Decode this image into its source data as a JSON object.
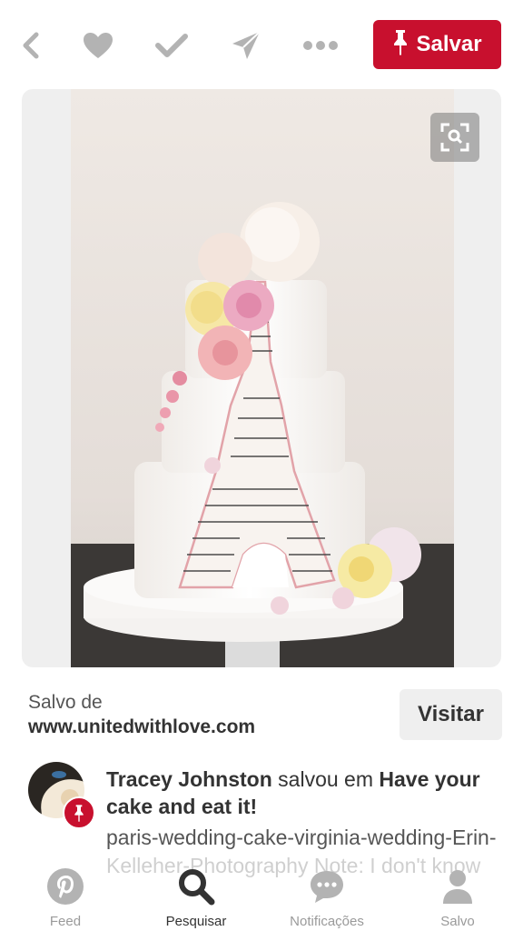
{
  "toolbar": {
    "back_icon": "chevron-left-icon",
    "like_icon": "heart-icon",
    "done_icon": "checkmark-icon",
    "send_icon": "send-icon",
    "more_icon": "more-dots-icon",
    "save_label": "Salvar",
    "save_color": "#c8102e"
  },
  "pin": {
    "image_subject": "",
    "lens_icon": "visual-search-icon"
  },
  "source": {
    "label": "Salvo de",
    "url": "www.unitedwithlove.com",
    "visit_label": "Visitar"
  },
  "saver": {
    "name": "Tracey Johnston",
    "action": "salvou em",
    "board": "Have your cake and eat it!",
    "description": "paris-wedding-cake-virginia-wedding-Erin-Kelleher-Photography Note: I don't know what the designer/decorator is"
  },
  "tabs": [
    {
      "label": "Feed",
      "icon": "pinterest-logo-icon"
    },
    {
      "label": "Pesquisar",
      "icon": "search-icon"
    },
    {
      "label": "Notificações",
      "icon": "chat-bubble-icon"
    },
    {
      "label": "Salvo",
      "icon": "person-icon"
    }
  ],
  "colors": {
    "accent": "#c8102e",
    "icon_gray": "#b3b3b3",
    "card_bg": "#efefef"
  }
}
